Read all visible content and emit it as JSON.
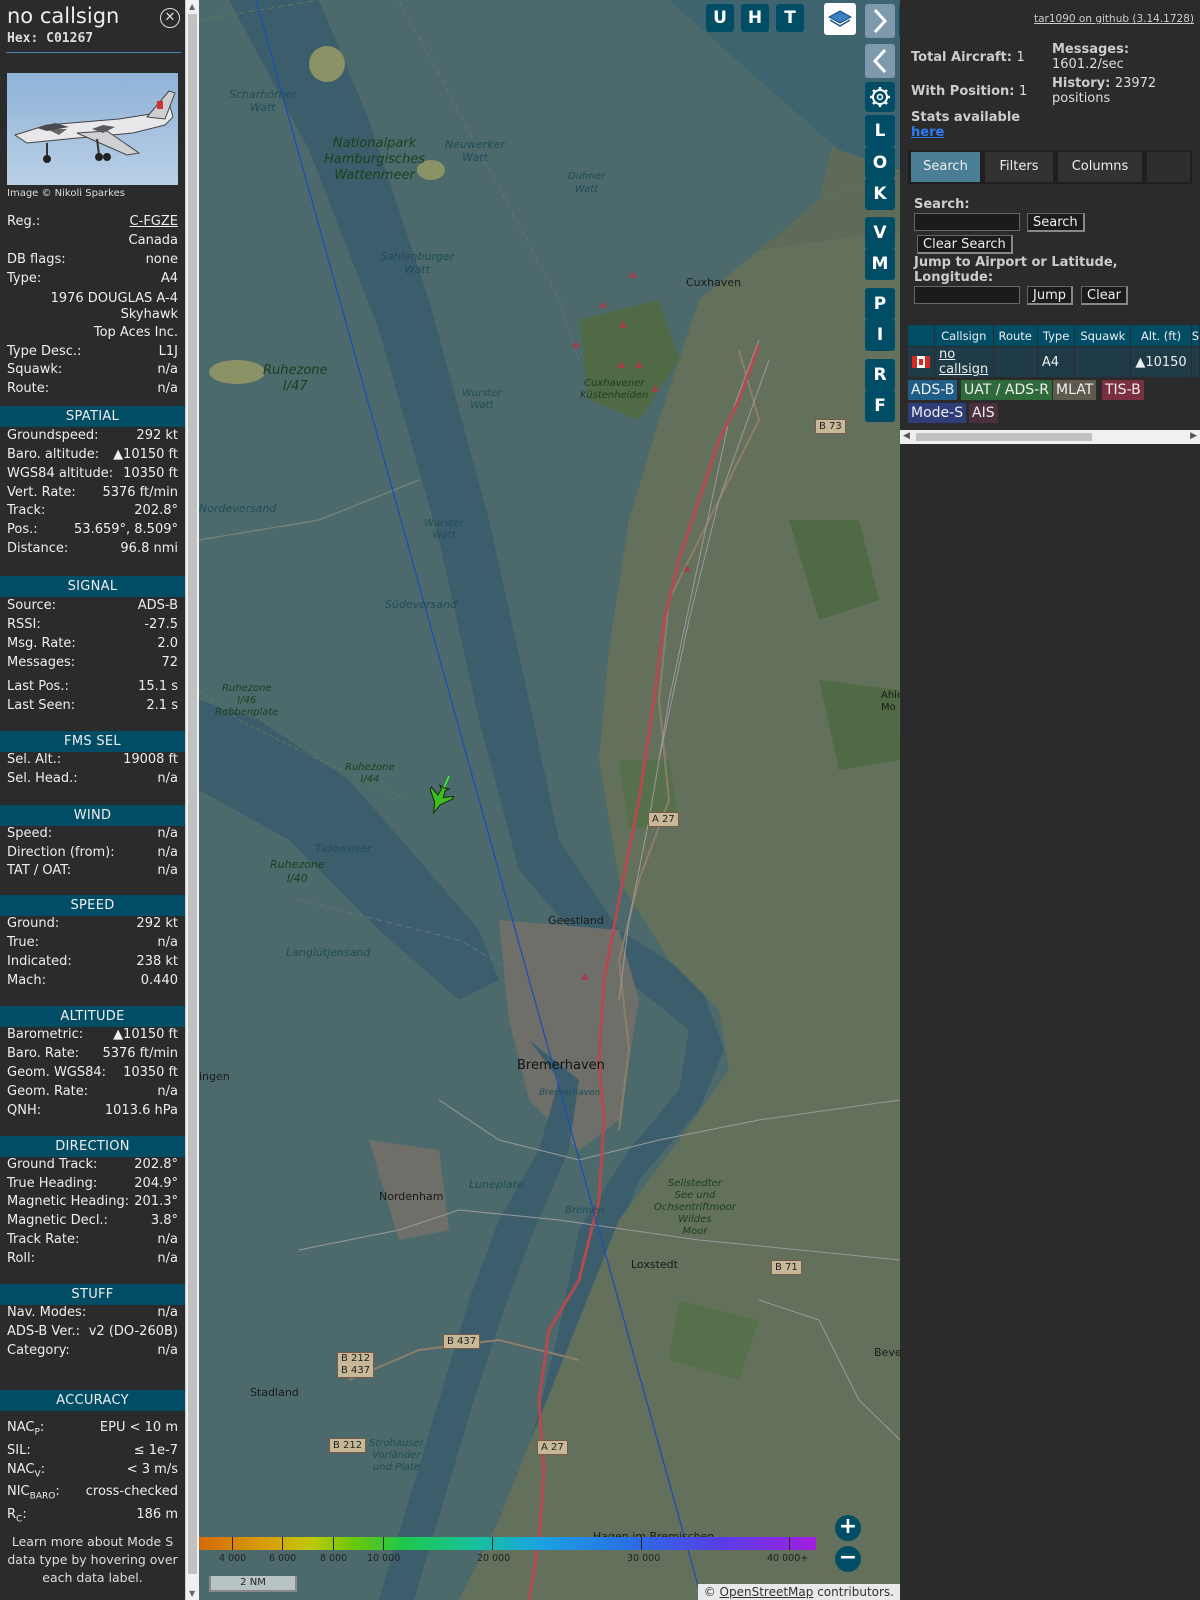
{
  "sidebar": {
    "title": "no callsign",
    "hex": "Hex: C01267",
    "photo_credit": "Image © Nikoli Sparkes",
    "info": {
      "reg_label": "Reg.:",
      "reg_value": "C-FGZE",
      "country": "Canada",
      "dbflags_label": "DB flags:",
      "dbflags_value": "none",
      "type_label": "Type:",
      "type_value": "A4",
      "type_full_1": "1976 DOUGLAS A-4",
      "type_full_2": "Skyhawk",
      "operator": "Top Aces Inc.",
      "typedesc_label": "Type Desc.:",
      "typedesc_value": "L1J",
      "squawk_label": "Squawk:",
      "squawk_value": "n/a",
      "route_label": "Route:",
      "route_value": "n/a"
    },
    "sections": {
      "spatial": "SPATIAL",
      "signal": "SIGNAL",
      "fms": "FMS SEL",
      "wind": "WIND",
      "speed": "SPEED",
      "altitude": "ALTITUDE",
      "direction": "DIRECTION",
      "stuff": "STUFF",
      "accuracy": "ACCURACY"
    },
    "spatial": [
      {
        "k": "Groundspeed:",
        "v": "292 kt"
      },
      {
        "k": "Baro. altitude:",
        "v": "▲10150 ft"
      },
      {
        "k": "WGS84 altitude:",
        "v": "10350 ft"
      },
      {
        "k": "Vert. Rate:",
        "v": "5376 ft/min"
      },
      {
        "k": "Track:",
        "v": "202.8°"
      },
      {
        "k": "Pos.:",
        "v": "53.659°, 8.509°"
      },
      {
        "k": "Distance:",
        "v": "96.8 nmi"
      }
    ],
    "signal": [
      {
        "k": "Source:",
        "v": "ADS-B"
      },
      {
        "k": "RSSI:",
        "v": "-27.5"
      },
      {
        "k": "Msg. Rate:",
        "v": "2.0"
      },
      {
        "k": "Messages:",
        "v": "72"
      },
      {
        "k": "Last Pos.:",
        "v": "15.1 s"
      },
      {
        "k": "Last Seen:",
        "v": "2.1 s"
      }
    ],
    "fms": [
      {
        "k": "Sel. Alt.:",
        "v": "19008 ft"
      },
      {
        "k": "Sel. Head.:",
        "v": "n/a"
      }
    ],
    "wind": [
      {
        "k": "Speed:",
        "v": "n/a"
      },
      {
        "k": "Direction (from):",
        "v": "n/a"
      },
      {
        "k": "TAT / OAT:",
        "v": "n/a"
      }
    ],
    "speed": [
      {
        "k": "Ground:",
        "v": "292 kt"
      },
      {
        "k": "True:",
        "v": "n/a"
      },
      {
        "k": "Indicated:",
        "v": "238 kt"
      },
      {
        "k": "Mach:",
        "v": "0.440"
      }
    ],
    "altitude": [
      {
        "k": "Barometric:",
        "v": "▲10150 ft"
      },
      {
        "k": "Baro. Rate:",
        "v": "5376 ft/min"
      },
      {
        "k": "Geom. WGS84:",
        "v": "10350 ft"
      },
      {
        "k": "Geom. Rate:",
        "v": "n/a"
      },
      {
        "k": "QNH:",
        "v": "1013.6 hPa"
      }
    ],
    "direction": [
      {
        "k": "Ground Track:",
        "v": "202.8°"
      },
      {
        "k": "True Heading:",
        "v": "204.9°"
      },
      {
        "k": "Magnetic Heading:",
        "v": "201.3°"
      },
      {
        "k": "Magnetic Decl.:",
        "v": "3.8°"
      },
      {
        "k": "Track Rate:",
        "v": "n/a"
      },
      {
        "k": "Roll:",
        "v": "n/a"
      }
    ],
    "stuff": [
      {
        "k": "Nav. Modes:",
        "v": "n/a"
      },
      {
        "k": "ADS-B Ver.:",
        "v": "v2 (DO-260B)"
      },
      {
        "k": "Category:",
        "v": "n/a"
      }
    ],
    "accuracy": {
      "nacp_k": "NAC",
      "nacp_sub": "P",
      "nacp_v": "EPU < 10 m",
      "sil_k": "SIL:",
      "sil_v": "≤ 1e-7",
      "nacv_k": "NAC",
      "nacv_sub": "V",
      "nacv_v": "< 3 m/s",
      "nic_k": "NIC",
      "nic_sub": "BARO",
      "nic_v": "cross-checked",
      "rc_k": "R",
      "rc_sub": "C",
      "rc_v": "186 m"
    },
    "footnote_1": "Learn more about Mode S",
    "footnote_2": "data type by hovering over",
    "footnote_3": "each data label."
  },
  "map": {
    "buttons": {
      "u": "U",
      "h": "H",
      "t": "T",
      "l": "L",
      "o": "O",
      "k": "K",
      "v": "V",
      "m": "M",
      "p": "P",
      "i": "I",
      "r": "R",
      "f": "F"
    },
    "labels": {
      "scharhorner": "Scharhörner\nWatt",
      "nationalpark": "Nationalpark\nHamburgisches\nWattenmeer",
      "neuwerker": "Neuwerker\nWatt",
      "duhner": "Duhner\nWatt",
      "sahlenburger": "Sahlenburger\nWatt",
      "cuxhaven": "Cuxhaven",
      "cuxhavener": "Cuxhavener\nKüstenheiden",
      "ruhezone47": "Ruhezone\nI/47",
      "wurster1": "Wurster\nWatt",
      "wurster2": "Wurster\nWatt",
      "nordeversand": "Nordeversand",
      "sudeversand": "Südeversand",
      "ruhezone46": "Ruhezone\nI/46\nRobbenplate",
      "ruhezone44": "Ruhezone\nI/44",
      "tideweser": "Tideweser",
      "ruhezone40": "Ruhezone\nI/40",
      "geestland": "Geestland",
      "langlutjensand": "Langlütjensand",
      "bremerhaven": "Bremerhaven",
      "bremerhaven2": "Bremerhaven",
      "ingen": "ingen",
      "sellstedter": "Sellstedter\nSee und\nOchsentriftmoor\nWildes\nMoor",
      "nordenham": "Nordenham",
      "luneplate": "Luneplate",
      "bremen": "Bremen",
      "loxstedt": "Loxstedt",
      "stadland": "Stadland",
      "strohauser": "Strohauser\nVorländer\nund Plate",
      "bever": "Bever",
      "ahlen": "Ahlen\nMo",
      "hagen": "Hagen im Bremischen"
    },
    "roads": {
      "b73": "B 73",
      "a27a": "A 27",
      "b71": "B 71",
      "b437": "B 437",
      "b212a": "B 212\nB 437",
      "b212b": "B 212",
      "a27b": "A 27"
    },
    "legend_ticks": [
      "4 000",
      "6 000",
      "8 000",
      "10 000",
      "20 000",
      "30 000",
      "40 000+"
    ],
    "scale": "2 NM",
    "osm_attr_prefix": "© ",
    "osm_attr_link": "OpenStreetMap",
    "osm_attr_suffix": " contributors."
  },
  "panel": {
    "github": "tar1090 on github (3.14.1728)",
    "total_aircraft_k": "Total Aircraft:",
    "total_aircraft_v": "1",
    "with_position_k": "With Position:",
    "with_position_v": "1",
    "stats_available": "Stats available",
    "stats_link": "here",
    "messages_k": "Messages:",
    "messages_v": "1601.2/sec",
    "history_k": "History:",
    "history_v_1": "23972",
    "history_v_2": "positions",
    "tabs": [
      "Search",
      "Filters",
      "Columns"
    ],
    "search_label": "Search:",
    "search_button": "Search",
    "clear_search_button": "Clear Search",
    "jump_label": "Jump to Airport or Latitude, Longitude:",
    "jump_button": "Jump",
    "clear_button": "Clear",
    "table": {
      "headers": [
        "",
        "Callsign",
        "Route",
        "Type",
        "Squawk",
        "Alt. (ft)",
        "S"
      ],
      "row": {
        "callsign": "no callsign",
        "route": "",
        "type": "A4",
        "squawk": "",
        "alt": "▲10150"
      }
    },
    "sources": [
      {
        "label": "ADS-B",
        "color": "#1f5e86"
      },
      {
        "label": "UAT / ADS-R",
        "color": "#2f6b3a"
      },
      {
        "label": "MLAT",
        "color": "#5e5a4e"
      },
      {
        "label": "TIS-B",
        "color": "#7a2f3e"
      },
      {
        "label": "Mode-S",
        "color": "#2f3e78"
      },
      {
        "label": "AIS",
        "color": "#4a2f3e"
      }
    ]
  }
}
